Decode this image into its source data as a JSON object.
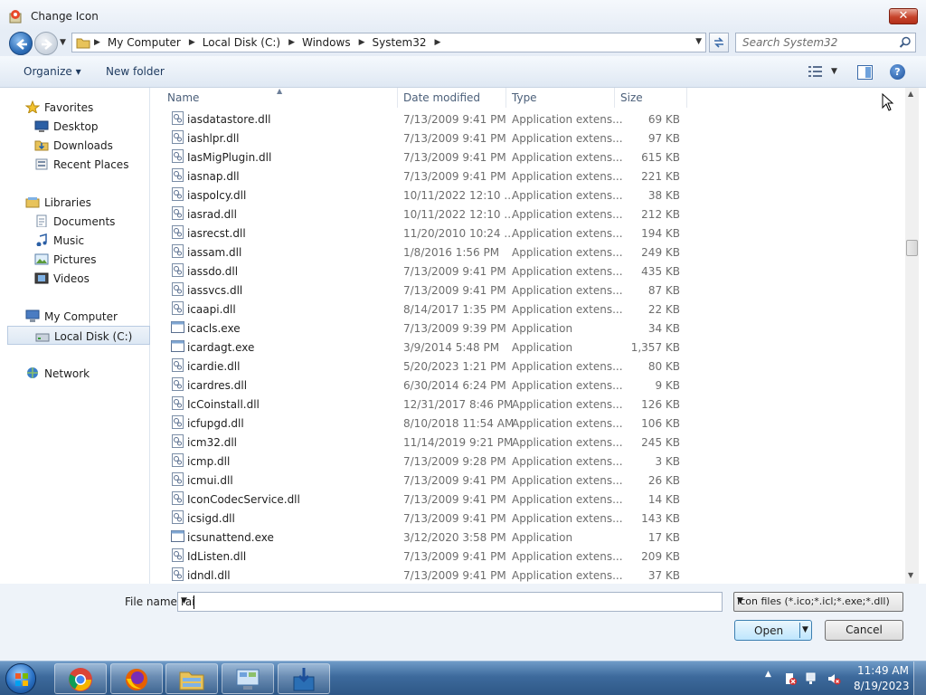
{
  "window": {
    "title": "Change Icon",
    "close_glyph": "✕"
  },
  "address": {
    "crumbs": [
      "My Computer",
      "Local Disk (C:)",
      "Windows",
      "System32"
    ],
    "search_placeholder": "Search System32"
  },
  "toolbar": {
    "organize_label": "Organize ▾",
    "new_folder_label": "New folder",
    "help_glyph": "?"
  },
  "nav": {
    "items": [
      {
        "label": "Favorites",
        "icon": "star-icon",
        "kind": "group"
      },
      {
        "label": "Desktop",
        "icon": "desktop-icon",
        "kind": "child"
      },
      {
        "label": "Downloads",
        "icon": "downloads-folder-icon",
        "kind": "child"
      },
      {
        "label": "Recent Places",
        "icon": "recent-places-icon",
        "kind": "child"
      },
      {
        "label": "Libraries",
        "icon": "libraries-icon",
        "kind": "group"
      },
      {
        "label": "Documents",
        "icon": "documents-icon",
        "kind": "child"
      },
      {
        "label": "Music",
        "icon": "music-icon",
        "kind": "child"
      },
      {
        "label": "Pictures",
        "icon": "pictures-icon",
        "kind": "child"
      },
      {
        "label": "Videos",
        "icon": "videos-icon",
        "kind": "child"
      },
      {
        "label": "My Computer",
        "icon": "computer-icon",
        "kind": "group"
      },
      {
        "label": "Local Disk (C:)",
        "icon": "disk-icon",
        "kind": "child",
        "selected": true
      },
      {
        "label": "Network",
        "icon": "network-icon",
        "kind": "group"
      }
    ]
  },
  "columns": {
    "name": "Name",
    "date": "Date modified",
    "type": "Type",
    "size": "Size"
  },
  "files": [
    {
      "name": "iasdatastore.dll",
      "date": "7/13/2009 9:41 PM",
      "type": "Application extens...",
      "size": "69 KB",
      "icon": "dll"
    },
    {
      "name": "iashlpr.dll",
      "date": "7/13/2009 9:41 PM",
      "type": "Application extens...",
      "size": "97 KB",
      "icon": "dll"
    },
    {
      "name": "IasMigPlugin.dll",
      "date": "7/13/2009 9:41 PM",
      "type": "Application extens...",
      "size": "615 KB",
      "icon": "dll"
    },
    {
      "name": "iasnap.dll",
      "date": "7/13/2009 9:41 PM",
      "type": "Application extens...",
      "size": "221 KB",
      "icon": "dll"
    },
    {
      "name": "iaspolcy.dll",
      "date": "10/11/2022 12:10 ...",
      "type": "Application extens...",
      "size": "38 KB",
      "icon": "dll"
    },
    {
      "name": "iasrad.dll",
      "date": "10/11/2022 12:10 ...",
      "type": "Application extens...",
      "size": "212 KB",
      "icon": "dll"
    },
    {
      "name": "iasrecst.dll",
      "date": "11/20/2010 10:24 ...",
      "type": "Application extens...",
      "size": "194 KB",
      "icon": "dll"
    },
    {
      "name": "iassam.dll",
      "date": "1/8/2016 1:56 PM",
      "type": "Application extens...",
      "size": "249 KB",
      "icon": "dll"
    },
    {
      "name": "iassdo.dll",
      "date": "7/13/2009 9:41 PM",
      "type": "Application extens...",
      "size": "435 KB",
      "icon": "dll"
    },
    {
      "name": "iassvcs.dll",
      "date": "7/13/2009 9:41 PM",
      "type": "Application extens...",
      "size": "87 KB",
      "icon": "dll"
    },
    {
      "name": "icaapi.dll",
      "date": "8/14/2017 1:35 PM",
      "type": "Application extens...",
      "size": "22 KB",
      "icon": "dll"
    },
    {
      "name": "icacls.exe",
      "date": "7/13/2009 9:39 PM",
      "type": "Application",
      "size": "34 KB",
      "icon": "exe"
    },
    {
      "name": "icardagt.exe",
      "date": "3/9/2014 5:48 PM",
      "type": "Application",
      "size": "1,357 KB",
      "icon": "exe"
    },
    {
      "name": "icardie.dll",
      "date": "5/20/2023 1:21 PM",
      "type": "Application extens...",
      "size": "80 KB",
      "icon": "dll"
    },
    {
      "name": "icardres.dll",
      "date": "6/30/2014 6:24 PM",
      "type": "Application extens...",
      "size": "9 KB",
      "icon": "dll"
    },
    {
      "name": "IcCoinstall.dll",
      "date": "12/31/2017 8:46 PM",
      "type": "Application extens...",
      "size": "126 KB",
      "icon": "dll"
    },
    {
      "name": "icfupgd.dll",
      "date": "8/10/2018 11:54 AM",
      "type": "Application extens...",
      "size": "106 KB",
      "icon": "dll"
    },
    {
      "name": "icm32.dll",
      "date": "11/14/2019 9:21 PM",
      "type": "Application extens...",
      "size": "245 KB",
      "icon": "dll"
    },
    {
      "name": "icmp.dll",
      "date": "7/13/2009 9:28 PM",
      "type": "Application extens...",
      "size": "3 KB",
      "icon": "dll"
    },
    {
      "name": "icmui.dll",
      "date": "7/13/2009 9:41 PM",
      "type": "Application extens...",
      "size": "26 KB",
      "icon": "dll"
    },
    {
      "name": "IconCodecService.dll",
      "date": "7/13/2009 9:41 PM",
      "type": "Application extens...",
      "size": "14 KB",
      "icon": "dll"
    },
    {
      "name": "icsigd.dll",
      "date": "7/13/2009 9:41 PM",
      "type": "Application extens...",
      "size": "143 KB",
      "icon": "dll"
    },
    {
      "name": "icsunattend.exe",
      "date": "3/12/2020 3:58 PM",
      "type": "Application",
      "size": "17 KB",
      "icon": "exe"
    },
    {
      "name": "IdListen.dll",
      "date": "7/13/2009 9:41 PM",
      "type": "Application extens...",
      "size": "209 KB",
      "icon": "dll"
    },
    {
      "name": "idndl.dll",
      "date": "7/13/2009 9:41 PM",
      "type": "Application extens...",
      "size": "37 KB",
      "icon": "dll"
    }
  ],
  "bottom": {
    "file_name_label": "File name:",
    "file_name_value": "rai",
    "filter_value": "Icon files (*.ico;*.icl;*.exe;*.dll)",
    "open_label": "Open",
    "cancel_label": "Cancel"
  },
  "taskbar": {
    "apps": [
      "chrome-icon",
      "firefox-icon",
      "file-explorer-icon",
      "control-panel-icon",
      "installer-icon"
    ],
    "clock_time": "11:49 AM",
    "clock_date": "8/19/2023"
  },
  "colors": {
    "accent": "#2f6fb8",
    "selection": "#dde8f4",
    "close": "#c7432b"
  }
}
